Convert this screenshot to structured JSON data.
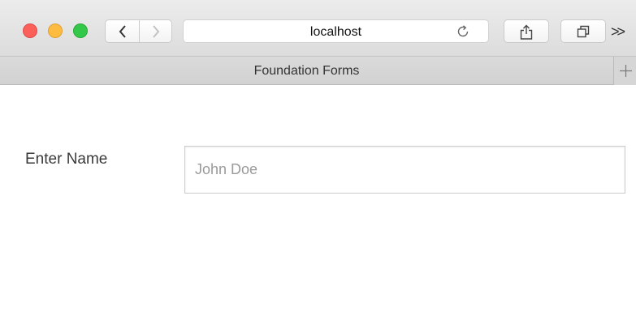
{
  "browser": {
    "address": "localhost",
    "tab_title": "Foundation Forms",
    "overflow_label": ">>"
  },
  "form": {
    "name_label": "Enter Name",
    "name_value": "",
    "name_placeholder": "John Doe"
  },
  "colors": {
    "close": "#fc605b",
    "minimize": "#fdbc40",
    "maximize": "#34c84a"
  }
}
